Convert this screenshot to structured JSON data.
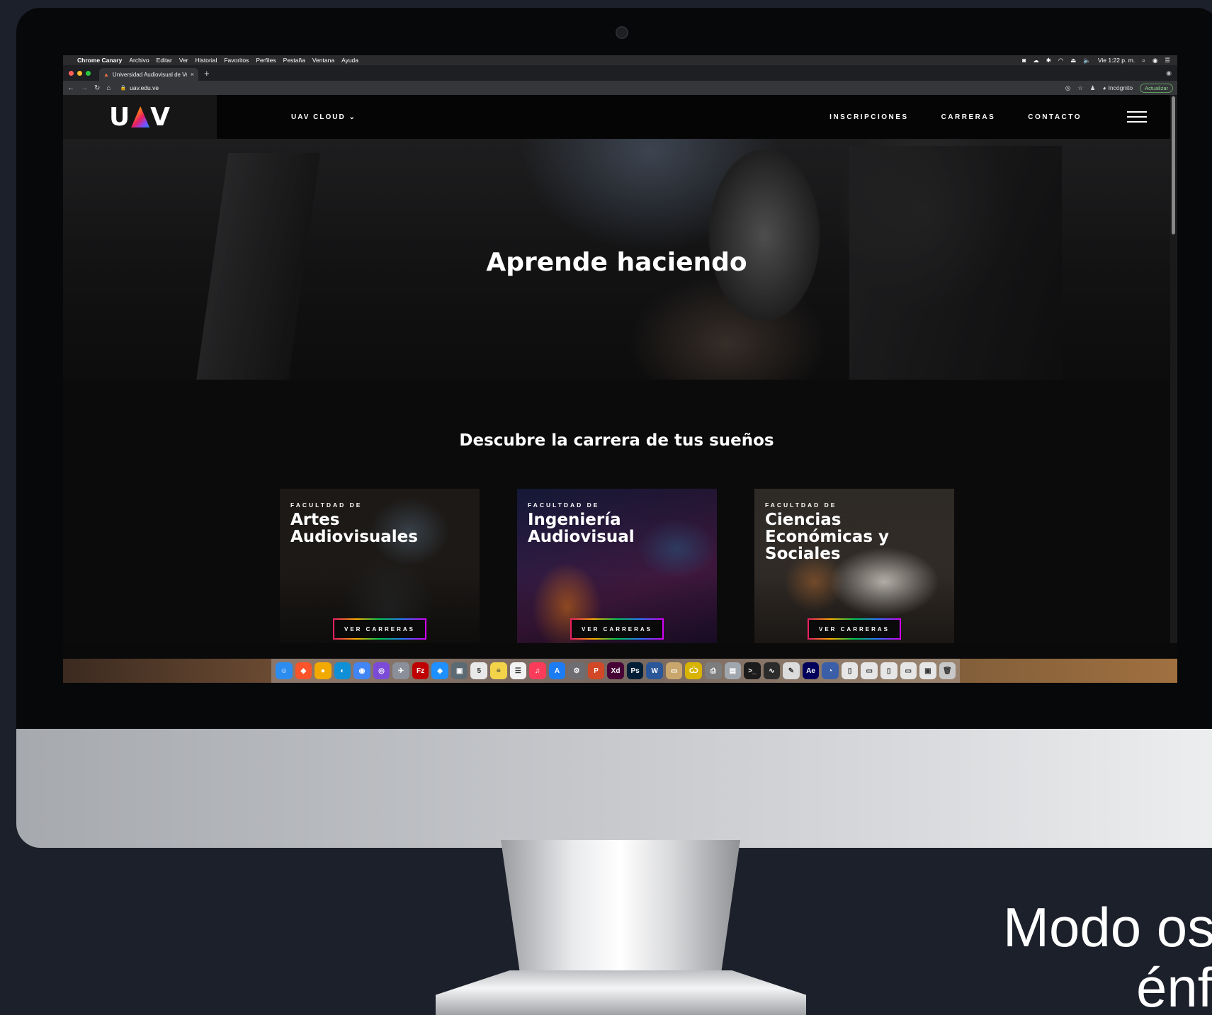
{
  "menubar": {
    "app_name": "Chrome Canary",
    "items": [
      "Archivo",
      "Editar",
      "Ver",
      "Historial",
      "Favoritos",
      "Perfiles",
      "Pestaña",
      "Ventana",
      "Ayuda"
    ],
    "clock": "Vie 1:22 p. m."
  },
  "browser": {
    "tab_title": "Universidad Audiovisual de Ve",
    "url": "uav.edu.ve",
    "profile_label": "Incógnito",
    "update_label": "Actualizar"
  },
  "site": {
    "logo_left": "U",
    "logo_right": "V",
    "nav_cloud": "UAV CLOUD ⌄",
    "nav_items": [
      "INSCRIPCIONES",
      "CARRERAS",
      "CONTACTO"
    ],
    "hero_title": "Aprende haciendo",
    "section_title": "Descubre la carrera de tus sueños",
    "cards": [
      {
        "kicker": "FACULTDAD DE",
        "name": "Artes Audiovisuales",
        "button": "VER CARRERAS"
      },
      {
        "kicker": "FACULTDAD DE",
        "name": "Ingeniería Audiovisual",
        "button": "VER CARRERAS"
      },
      {
        "kicker": "FACULTDAD DE",
        "name": "Ciencias Económicas y Sociales",
        "button": "VER CARRERAS"
      }
    ]
  },
  "dock": {
    "apps": [
      {
        "icon": "finder-icon",
        "glyph": "☺",
        "color": "#2d8cf0"
      },
      {
        "icon": "brave-icon",
        "glyph": "◆",
        "color": "#fb542b"
      },
      {
        "icon": "chrome-canary-icon",
        "glyph": "●",
        "color": "#f2a900"
      },
      {
        "icon": "edge-icon",
        "glyph": "◐",
        "color": "#0f8fd6"
      },
      {
        "icon": "chrome-icon",
        "glyph": "◉",
        "color": "#4285f4"
      },
      {
        "icon": "siri-icon",
        "glyph": "◎",
        "color": "#7b4bd8"
      },
      {
        "icon": "launchpad-icon",
        "glyph": "✈",
        "color": "#8a8f99"
      },
      {
        "icon": "filezilla-icon",
        "glyph": "Fz",
        "color": "#bf0000"
      },
      {
        "icon": "safari-icon",
        "glyph": "◈",
        "color": "#1e90ff"
      },
      {
        "icon": "preview-icon",
        "glyph": "▣",
        "color": "#5c6b73"
      },
      {
        "icon": "calendar-icon",
        "glyph": "5",
        "color": "#e8e8e8"
      },
      {
        "icon": "notes-icon",
        "glyph": "≡",
        "color": "#f3d34a"
      },
      {
        "icon": "reminders-icon",
        "glyph": "☰",
        "color": "#f2f2f2"
      },
      {
        "icon": "music-icon",
        "glyph": "♫",
        "color": "#fa3c5a"
      },
      {
        "icon": "app-store-icon",
        "glyph": "A",
        "color": "#1c7cf4"
      },
      {
        "icon": "system-preferences-icon",
        "glyph": "⚙",
        "color": "#6d6d72"
      },
      {
        "icon": "powerpoint-icon",
        "glyph": "P",
        "color": "#d24726"
      },
      {
        "icon": "xd-icon",
        "glyph": "Xd",
        "color": "#470137"
      },
      {
        "icon": "photoshop-icon",
        "glyph": "Ps",
        "color": "#001e36"
      },
      {
        "icon": "word-icon",
        "glyph": "W",
        "color": "#2b579a"
      },
      {
        "icon": "folder-icon",
        "glyph": "▭",
        "color": "#c9a66b"
      },
      {
        "icon": "coda-icon",
        "glyph": "Ѿ",
        "color": "#d8b400"
      },
      {
        "icon": "printer-icon",
        "glyph": "⎙",
        "color": "#7d7d7d"
      },
      {
        "icon": "archive-icon",
        "glyph": "▤",
        "color": "#a0a6ad"
      },
      {
        "icon": "terminal-icon",
        "glyph": ">_",
        "color": "#1b1b1b"
      },
      {
        "icon": "activity-monitor-icon",
        "glyph": "∿",
        "color": "#2b2b2b"
      },
      {
        "icon": "script-editor-icon",
        "glyph": "✎",
        "color": "#dcdcdc"
      },
      {
        "icon": "after-effects-icon",
        "glyph": "Ae",
        "color": "#00005b"
      },
      {
        "icon": "quicktime-icon",
        "glyph": "◔",
        "color": "#3a5fa8"
      },
      {
        "icon": "document-icon",
        "glyph": "▯",
        "color": "#e6e6e6"
      },
      {
        "icon": "mail-doc-icon",
        "glyph": "▭",
        "color": "#e6e6e6"
      },
      {
        "icon": "text-doc-icon",
        "glyph": "▯",
        "color": "#e6e6e6"
      },
      {
        "icon": "image-doc-icon",
        "glyph": "▭",
        "color": "#e6e6e6"
      },
      {
        "icon": "downloads-icon",
        "glyph": "▣",
        "color": "#e6e6e6"
      },
      {
        "icon": "trash-icon",
        "glyph": "🗑",
        "color": "#c8c8c8"
      }
    ]
  },
  "caption": {
    "line1": "Modo os",
    "line2": "énf"
  }
}
